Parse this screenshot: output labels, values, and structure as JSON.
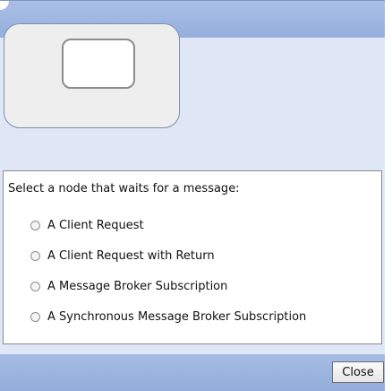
{
  "prompt": "Select a node that waits for a message:",
  "options": [
    {
      "label": "A Client Request",
      "selected": false
    },
    {
      "label": "A Client Request with Return",
      "selected": false
    },
    {
      "label": "A Message Broker Subscription",
      "selected": false
    },
    {
      "label": "A Synchronous Message Broker Subscription",
      "selected": false
    }
  ],
  "footer": {
    "close_label": "Close"
  },
  "colors": {
    "titlebar": "#95afdd",
    "panel": "#dfe7f6",
    "footer": "#93acda"
  }
}
